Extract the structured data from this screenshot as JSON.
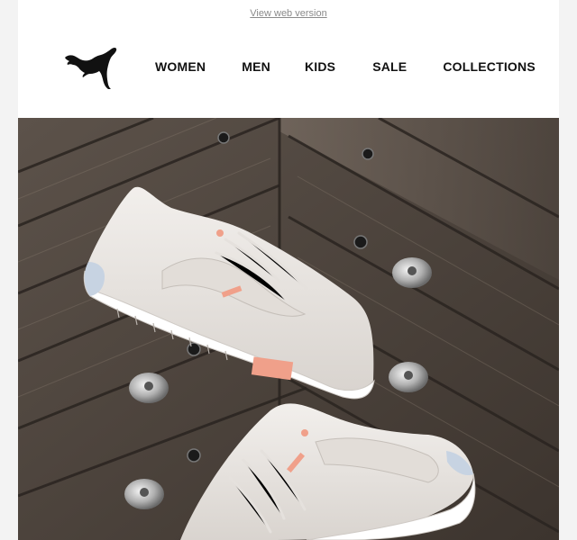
{
  "top_bar": {
    "view_web_version": "View web version"
  },
  "brand": {
    "logo_icon": "puma-cat-icon",
    "color": "#111111"
  },
  "nav": {
    "items": [
      {
        "label": "WOMEN"
      },
      {
        "label": "MEN"
      },
      {
        "label": "KIDS"
      },
      {
        "label": "SALE"
      },
      {
        "label": "COLLECTIONS"
      }
    ]
  },
  "hero": {
    "image_description_icon": "sneaker-photo",
    "colors": {
      "wood_dark": "#4a4038",
      "wood_light": "#8a7d70",
      "shoe": "#ece8e4",
      "accent_pink": "#f0a08a",
      "speckle_blue": "#b8c8dc"
    }
  }
}
